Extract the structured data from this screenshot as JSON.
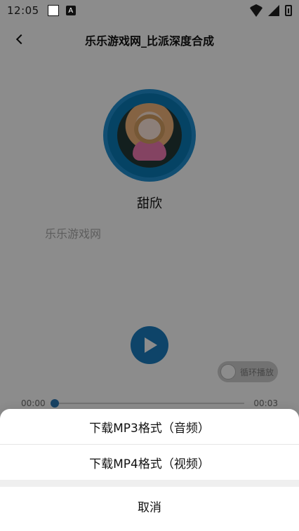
{
  "status_bar": {
    "time": "12:05",
    "icons": {
      "square": "square-icon",
      "a": "A",
      "wifi": "wifi-icon",
      "signal": "signal-icon",
      "battery": "battery-icon"
    }
  },
  "header": {
    "title": "乐乐游戏网_比派深度合成"
  },
  "player": {
    "song_title": "甜欣",
    "artist": "乐乐游戏网",
    "loop_label": "循环播放",
    "time_current": "00:00",
    "time_total": "00:03",
    "progress": 0.0
  },
  "sheet": {
    "option_mp3": "下载MP3格式（音频）",
    "option_mp4": "下载MP4格式（视频）",
    "cancel": "取消"
  },
  "colors": {
    "accent": "#1a7cc0"
  }
}
